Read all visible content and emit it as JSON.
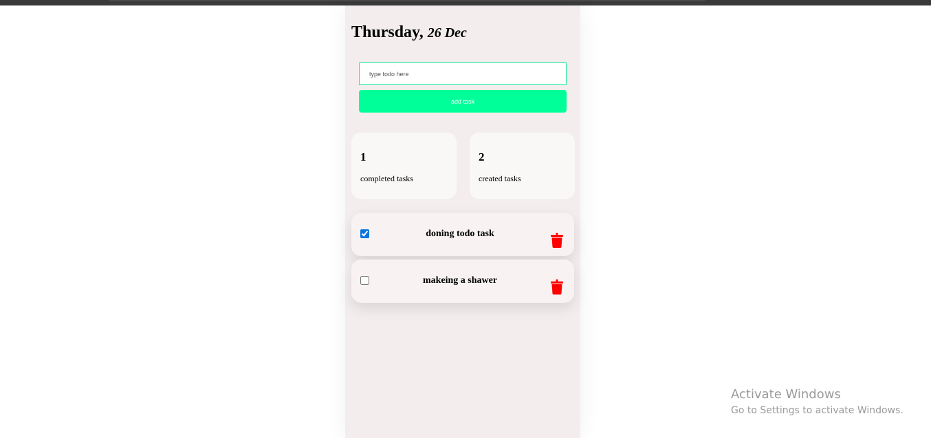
{
  "header": {
    "day": "Thursday,",
    "date": "26 Dec"
  },
  "input": {
    "placeholder": "type todo here",
    "value": ""
  },
  "add_button": {
    "label": "add task"
  },
  "stats": {
    "completed": {
      "count": "1",
      "label": "completed tasks"
    },
    "created": {
      "count": "2",
      "label": "created tasks"
    }
  },
  "tasks": [
    {
      "title": "doning todo task",
      "completed": true
    },
    {
      "title": "makeing a shawer",
      "completed": false
    }
  ],
  "icons": {
    "delete": "trash-icon"
  },
  "colors": {
    "accent": "#00ff99",
    "delete": "#ff0000",
    "panel": "#f3eded"
  },
  "windows_watermark": {
    "line1": "Activate Windows",
    "line2": "Go to Settings to activate Windows."
  }
}
